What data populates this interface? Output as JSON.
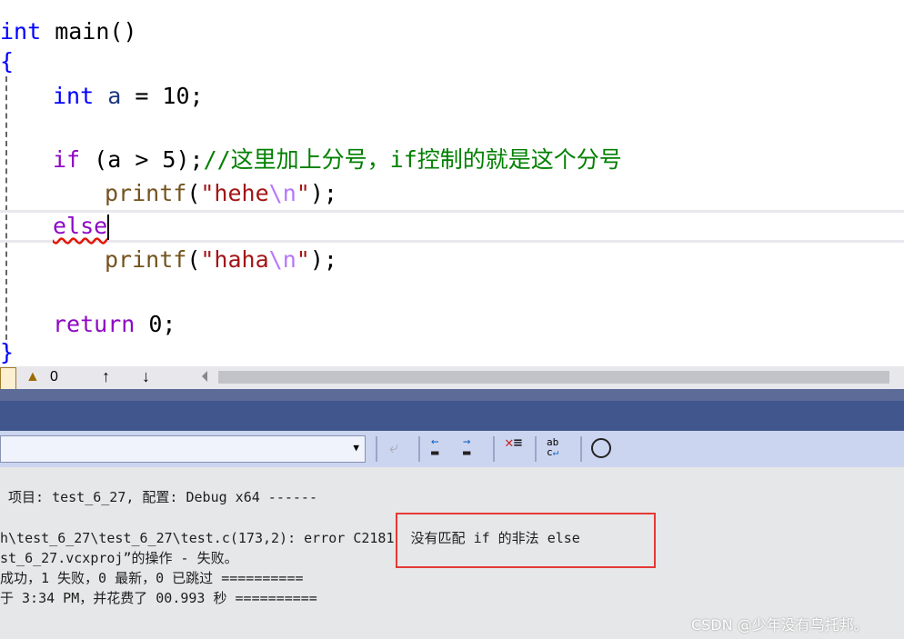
{
  "code": {
    "lines": [
      {
        "kw": "int",
        "rest": " main()"
      },
      {
        "text": "{"
      },
      {
        "kw": "int",
        "var": "a",
        "rest": " = 10;"
      },
      {
        "kw": "if",
        "mid": " (a > 5);",
        "comment": "//这里加上分号，if控制的就是这个分号"
      },
      {
        "fn": "printf",
        "open": "(",
        "q1": "\"hehe",
        "esc": "\\n",
        "q2": "\"",
        "close": ");"
      },
      {
        "kw": "else"
      },
      {
        "fn": "printf",
        "open": "(",
        "q1": "\"haha",
        "esc": "\\n",
        "q2": "\"",
        "close": ");"
      },
      {
        "kw": "return",
        "rest": " 0;"
      },
      {
        "text": "}"
      }
    ]
  },
  "status": {
    "warnings": "0",
    "up_icon": "arrow-up",
    "down_icon": "arrow-down"
  },
  "output": {
    "lines": [
      " 项目: test_6_27, 配置: Debug x64 ------",
      "h\\test_6_27\\test_6_27\\test.c(173,2): error C2181  没有匹配 if 的非法 else",
      "st_6_27.vcxproj”的操作 - 失败。",
      "成功，1 失败，0 最新，0 已跳过 ==========",
      "于 3:34 PM，并花费了 00.993 秒 =========="
    ],
    "highlight_color": "#e53935"
  },
  "watermark": "CSDN @少年没有乌托邦。"
}
